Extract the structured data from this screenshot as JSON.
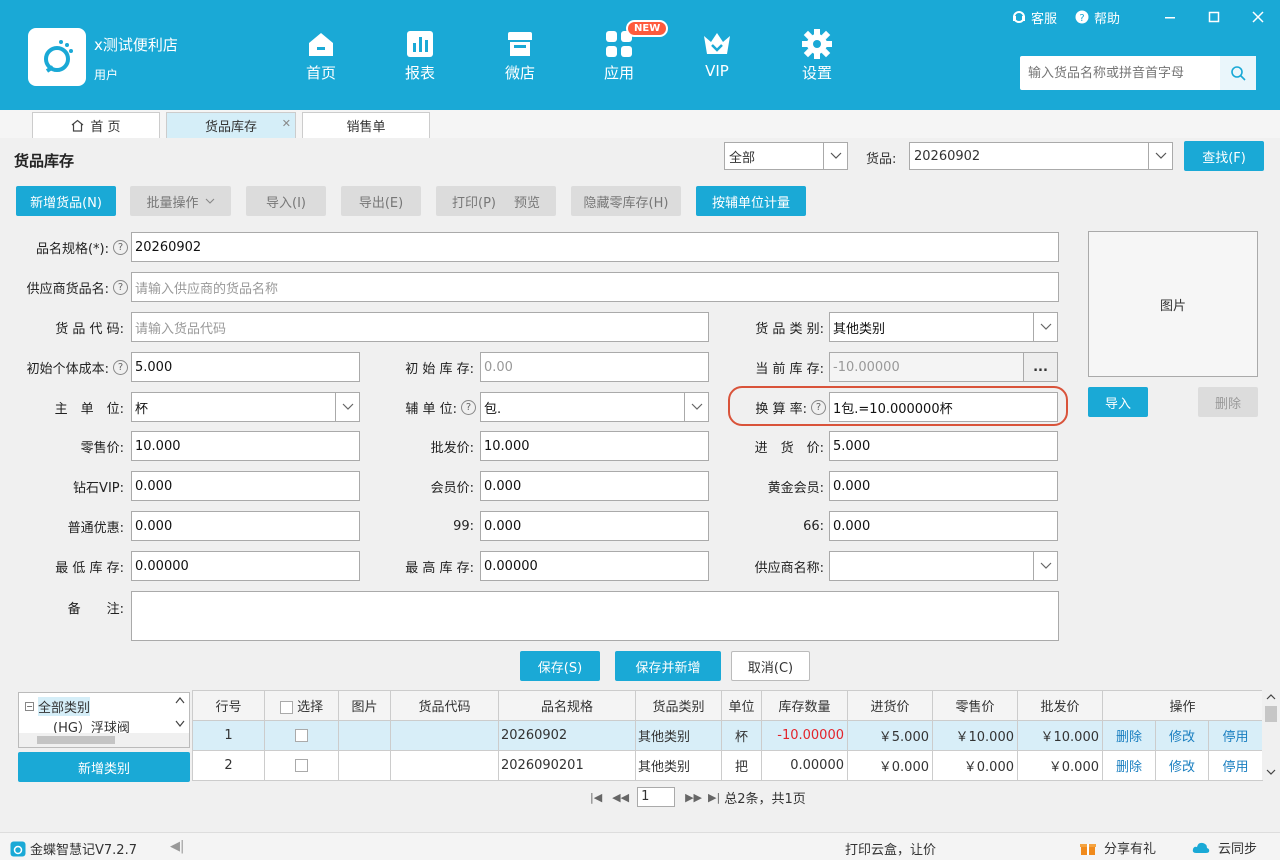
{
  "app": {
    "store_name": "x测试便利店",
    "user_label": "用户",
    "nav": [
      {
        "label": "首页",
        "icon": "home-icon"
      },
      {
        "label": "报表",
        "icon": "report-icon"
      },
      {
        "label": "微店",
        "icon": "shop-icon"
      },
      {
        "label": "应用",
        "icon": "apps-icon",
        "badge": "NEW"
      },
      {
        "label": "VIP",
        "icon": "vip-crown-icon"
      },
      {
        "label": "设置",
        "icon": "gear-icon"
      }
    ],
    "top_right": {
      "service": "客服",
      "help": "帮助"
    },
    "search_placeholder": "输入货品名称或拼音首字母"
  },
  "tabs": [
    {
      "label": "首 页"
    },
    {
      "label": "货品库存"
    },
    {
      "label": "销售单"
    }
  ],
  "panel": {
    "title": "货品库存",
    "filter_value": "全部",
    "goods_label": "货品:",
    "goods_value": "20260902",
    "find_label": "查找(F)"
  },
  "toolbar": {
    "add_goods": "新增货品(N)",
    "batch": "批量操作",
    "import": "导入(I)",
    "export": "导出(E)",
    "print": "打印(P)",
    "preview": "预览",
    "hide_zero": "隐藏零库存(H)",
    "aux_unit": "按辅单位计量"
  },
  "form": {
    "name_label": "品名规格(*):",
    "name_value": "20260902",
    "supplier_goods_label": "供应商货品名:",
    "supplier_goods_placeholder": "请输入供应商的货品名称",
    "code_label": "货 品 代 码:",
    "code_placeholder": "请输入货品代码",
    "category_label": "货 品 类 别:",
    "category_value": "其他类别",
    "init_cost_label": "初始个体成本:",
    "init_cost_value": "5.000",
    "init_stock_label": "初 始 库 存:",
    "init_stock_placeholder": "0.00",
    "current_stock_label": "当 前 库 存:",
    "current_stock_value": "-10.00000",
    "current_stock_btn": "...",
    "main_unit_label": "主　单　位:",
    "main_unit_value": "杯",
    "aux_unit_label": "辅 单 位:",
    "aux_unit_value": "包.",
    "rate_label": "换 算 率:",
    "rate_value": "1包.=10.000000杯",
    "retail_label": "零售价:",
    "retail_value": "10.000",
    "wholesale_label": "批发价:",
    "wholesale_value": "10.000",
    "purchase_label": "进　货　价:",
    "purchase_value": "5.000",
    "diamond_label": "钻石VIP:",
    "diamond_value": "0.000",
    "member_label": "会员价:",
    "member_value": "0.000",
    "gold_label": "黄金会员:",
    "gold_value": "0.000",
    "normal_label": "普通优惠:",
    "normal_value": "0.000",
    "p99_label": "99:",
    "p99_value": "0.000",
    "p66_label": "66:",
    "p66_value": "0.000",
    "min_stock_label": "最 低 库 存:",
    "min_stock_value": "0.00000",
    "max_stock_label": "最 高 库 存:",
    "max_stock_value": "0.00000",
    "supplier_label": "供应商名称:",
    "supplier_value": "",
    "remark_label": "备　　注:",
    "image_label": "图片",
    "image_import": "导入",
    "image_delete": "删除",
    "save": "保存(S)",
    "save_new": "保存并新增",
    "cancel": "取消(C)"
  },
  "tree": {
    "root": "全部类别",
    "child": "(HG）浮球阀",
    "add_category": "新增类别"
  },
  "table": {
    "headers": [
      "行号",
      "选择",
      "图片",
      "货品代码",
      "品名规格",
      "货品类别",
      "单位",
      "库存数量",
      "进货价",
      "零售价",
      "批发价",
      "操作"
    ],
    "rows": [
      {
        "no": "1",
        "code": "",
        "name": "20260902",
        "category": "其他类别",
        "unit": "杯",
        "stock": "-10.00000",
        "purchase": "￥5.000",
        "retail": "￥10.000",
        "wholesale": "￥10.000"
      },
      {
        "no": "2",
        "code": "",
        "name": "2026090201",
        "category": "其他类别",
        "unit": "把",
        "stock": "0.00000",
        "purchase": "￥0.000",
        "retail": "￥0.000",
        "wholesale": "￥0.000"
      }
    ],
    "actions": {
      "delete": "删除",
      "edit": "修改",
      "disable": "停用"
    }
  },
  "pager": {
    "page": "1",
    "summary": "总2条，共1页"
  },
  "status": {
    "version": "金蝶智慧记V7.2.7",
    "print_box": "打印云盒，让价",
    "share": "分享有礼",
    "sync": "云同步"
  },
  "colors": {
    "brand": "#1aa9d6",
    "highlight": "#d9533a",
    "negative": "#e3242b"
  }
}
